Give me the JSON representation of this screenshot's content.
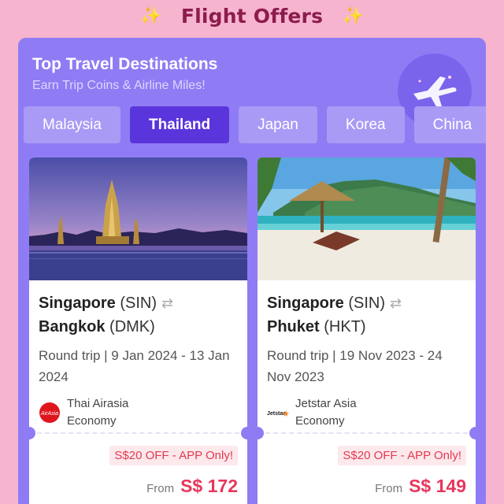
{
  "header": {
    "title": "Flight Offers",
    "icon_left": "sparkle-icon",
    "icon_right": "sparkle-icon"
  },
  "panel": {
    "title": "Top Travel Destinations",
    "subtitle": "Earn Trip Coins & Airline Miles!",
    "badge_icon": "airplane-icon"
  },
  "tabs": [
    {
      "label": "Malaysia",
      "active": false
    },
    {
      "label": "Thailand",
      "active": true
    },
    {
      "label": "Japan",
      "active": false
    },
    {
      "label": "Korea",
      "active": false
    },
    {
      "label": "China",
      "active": false
    }
  ],
  "offers": [
    {
      "origin_city": "Singapore",
      "origin_code": "(SIN)",
      "dest_city": "Bangkok",
      "dest_code": "(DMK)",
      "trip_type": "Round trip | 9 Jan 2024 - 13 Jan 2024",
      "airline": "Thai Airasia",
      "cabin": "Economy",
      "airline_logo": "airasia-logo",
      "promo": "S$20 OFF - APP Only!",
      "from_label": "From",
      "price": "S$ 172"
    },
    {
      "origin_city": "Singapore",
      "origin_code": "(SIN)",
      "dest_city": "Phuket",
      "dest_code": "(HKT)",
      "trip_type": "Round trip | 19 Nov 2023 - 24 Nov 2023",
      "airline": "Jetstar Asia",
      "cabin": "Economy",
      "airline_logo": "jetstar-logo",
      "promo": "S$20 OFF - APP Only!",
      "from_label": "From",
      "price": "S$ 149"
    }
  ],
  "colors": {
    "background": "#f7b4cf",
    "panel": "#8f7cf4",
    "tab_active": "#5a35db",
    "price": "#e8365d",
    "title": "#8b1d4d"
  }
}
